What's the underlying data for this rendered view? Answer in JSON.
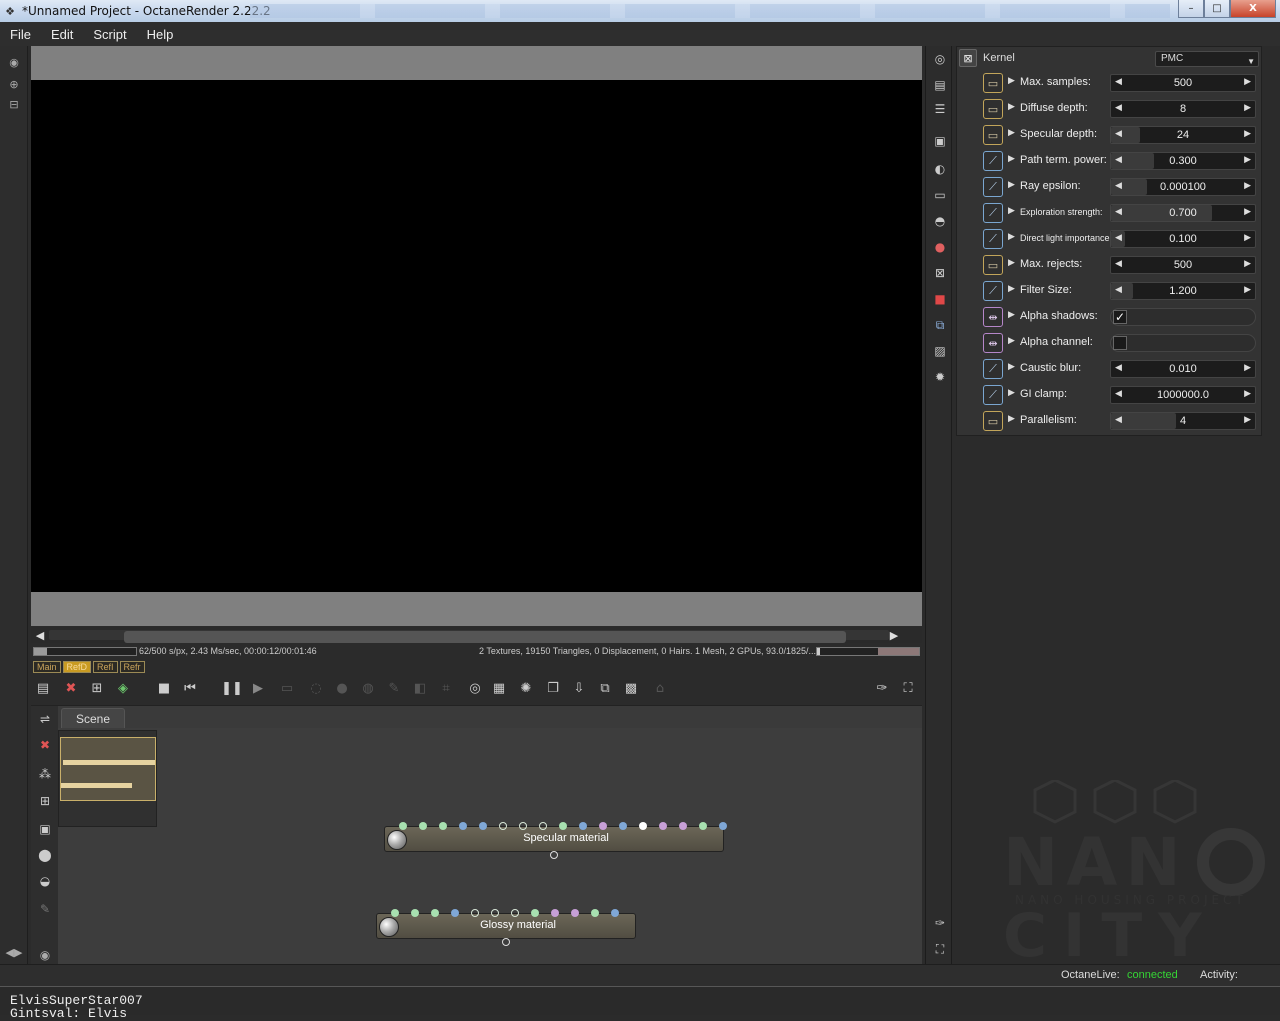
{
  "window": {
    "title": "*Unnamed Project - OctaneRender 2.22.2",
    "controls": [
      "–",
      "□",
      "X"
    ]
  },
  "menu": [
    "File",
    "Edit",
    "Script",
    "Help"
  ],
  "status": {
    "samples_text": "62/500 s/px, 2.43 Ms/sec, 00:00:12/00:01:46",
    "scene_text": "2 Textures, 19150 Triangles, 0 Displacement, 0 Hairs. 1 Mesh, 2 GPUs, 93.0/1825/...",
    "render_progress": 0.124
  },
  "passes": [
    {
      "label": "Main",
      "active": false
    },
    {
      "label": "RefD",
      "active": true
    },
    {
      "label": "RefI",
      "active": false
    },
    {
      "label": "Refr",
      "active": false
    }
  ],
  "graph": {
    "tab": "Scene",
    "nodes": [
      {
        "title": "Specular material",
        "pins": [
          "#a8e0b0",
          "#a8e0b0",
          "#a8e0b0",
          "#7fa7d6",
          "#7fa7d6",
          "hollow",
          "hollow",
          "hollow",
          "#a8e0b0",
          "#7fa7d6",
          "#c79fd6",
          "#7fa7d6",
          "#ffffff",
          "#c79fd6",
          "#c79fd6",
          "#a8e0b0",
          "#7fa7d6"
        ]
      },
      {
        "title": "Glossy material",
        "pins": [
          "#a8e0b0",
          "#a8e0b0",
          "#a8e0b0",
          "#7fa7d6",
          "hollow",
          "hollow",
          "hollow",
          "#a8e0b0",
          "#c79fd6",
          "#c79fd6",
          "#a8e0b0",
          "#7fa7d6"
        ]
      }
    ]
  },
  "kernel": {
    "label": "Kernel",
    "type": "PMC",
    "params": [
      {
        "kind": "int",
        "label": "Max. samples:",
        "value": "500",
        "fill": 0.0,
        "small": false
      },
      {
        "kind": "int",
        "label": "Diffuse depth:",
        "value": "8",
        "fill": 0.0,
        "small": false
      },
      {
        "kind": "int",
        "label": "Specular depth:",
        "value": "24",
        "fill": 0.2,
        "small": false
      },
      {
        "kind": "float",
        "label": "Path term. power:",
        "value": "0.300",
        "fill": 0.3,
        "small": false
      },
      {
        "kind": "float",
        "label": "Ray epsilon:",
        "value": "0.000100",
        "fill": 0.25,
        "small": false
      },
      {
        "kind": "float",
        "label": "Exploration strength:",
        "value": "0.700",
        "fill": 0.7,
        "small": true
      },
      {
        "kind": "float",
        "label": "Direct light importance:",
        "value": "0.100",
        "fill": 0.1,
        "small": true
      },
      {
        "kind": "int",
        "label": "Max. rejects:",
        "value": "500",
        "fill": 0.0,
        "small": false
      },
      {
        "kind": "float",
        "label": "Filter Size:",
        "value": "1.200",
        "fill": 0.15,
        "small": false
      },
      {
        "kind": "bool",
        "label": "Alpha shadows:",
        "checked": true
      },
      {
        "kind": "bool",
        "label": "Alpha channel:",
        "checked": false
      },
      {
        "kind": "float",
        "label": "Caustic blur:",
        "value": "0.010",
        "fill": 0.0,
        "small": false
      },
      {
        "kind": "float",
        "label": "GI clamp:",
        "value": "1000000.0",
        "fill": 0.0,
        "small": false
      },
      {
        "kind": "int",
        "label": "Parallelism:",
        "value": "4",
        "fill": 0.45,
        "small": false
      }
    ]
  },
  "bottom": {
    "octanelive_label": "OctaneLive:",
    "octanelive_status": "connected",
    "activity_label": "Activity:",
    "status_color": "#35d435"
  },
  "taskbar_lines": [
    "ElvisSuperStar007",
    "Gintsval: Elvis"
  ],
  "logo": {
    "line1": "NAN",
    "sub": "NANO HOUSING PROJECT",
    "line2": "CITY"
  }
}
